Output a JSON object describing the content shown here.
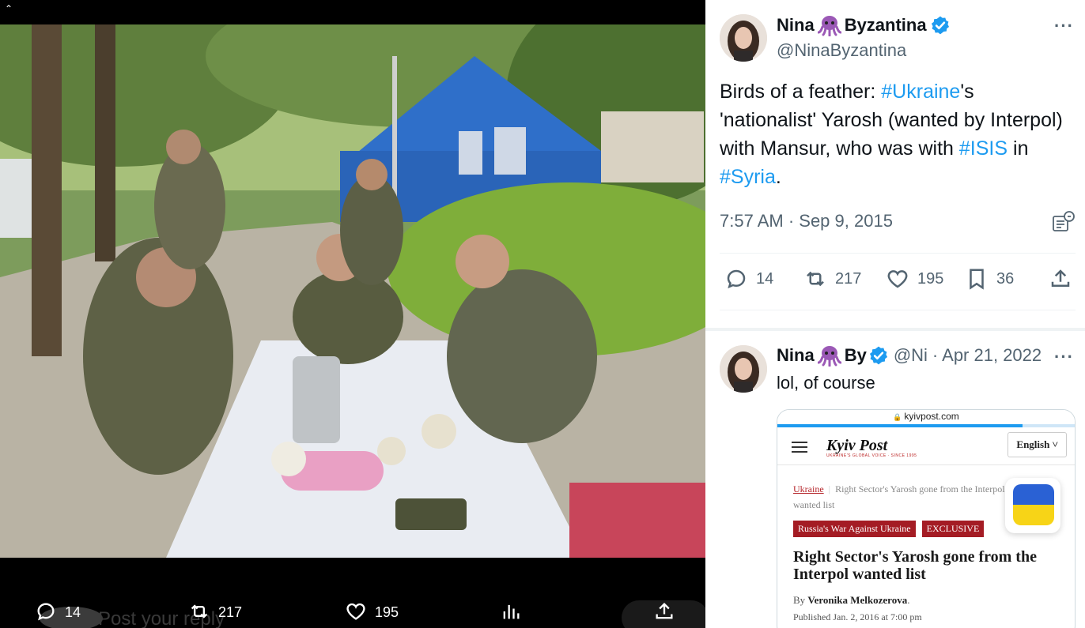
{
  "viewer": {
    "actions": {
      "replies": "14",
      "reposts": "217",
      "likes": "195"
    },
    "reply_placeholder": "Post your reply",
    "photo": {
      "subject": "Photo of armed men in camouflage seated at an outdoor table in front of a blue wooden building"
    }
  },
  "tweet": {
    "display_name_first": "Nina",
    "display_name_last": "Byzantina",
    "name_emoji_icon": "octopus-icon",
    "handle": "@NinaByzantina",
    "text_parts": {
      "p1": "Birds of a feather: ",
      "tag_ukraine": "#Ukraine",
      "p2": "'s 'nationalist' Yarosh (wanted by Interpol) with Mansur, who was with ",
      "tag_isis": "#ISIS",
      "p3": " in ",
      "tag_syria": "#Syria",
      "p4": "."
    },
    "timestamp": "7:57 AM · Sep 9, 2015",
    "stats": {
      "replies": "14",
      "reposts": "217",
      "likes": "195",
      "bookmarks": "36"
    }
  },
  "reply": {
    "name_first": "Nina",
    "name_trunc": "By",
    "handle_trunc": "@Ni",
    "date": "· Apr 21, 2022",
    "text": "lol, of course",
    "embed": {
      "url": "kyivpost.com",
      "logo": "Kyiv Post",
      "tagline": "UKRAINE'S GLOBAL VOICE · SINCE 1995",
      "language": "English",
      "crumb_section": "Ukraine",
      "crumb_title": "Right Sector's Yarosh gone from the Interpol wanted list",
      "badge_1": "Russia's War Against Ukraine",
      "badge_2": "EXCLUSIVE",
      "headline": "Right Sector's Yarosh gone from the Interpol wanted list",
      "by_label": "By",
      "author": "Veronika Melkozerova",
      "published": "Published Jan. 2, 2016 at 7:00 pm"
    }
  },
  "colors": {
    "accent": "#1d9bf0",
    "secondary_text": "#536471",
    "kyivpost_red": "#a41c24"
  }
}
